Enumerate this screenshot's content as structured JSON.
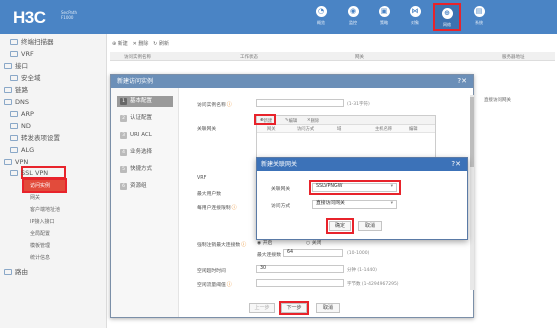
{
  "brand": {
    "logo": "H3C",
    "sub_line1": "SecPath",
    "sub_line2": "F1000"
  },
  "topnav": [
    {
      "label": "概览",
      "icon": "dashboard-icon",
      "glyph": "◔"
    },
    {
      "label": "监控",
      "icon": "monitor-icon",
      "glyph": "◉"
    },
    {
      "label": "策略",
      "icon": "policy-icon",
      "glyph": "▣"
    },
    {
      "label": "对象",
      "icon": "object-icon",
      "glyph": "⋈"
    },
    {
      "label": "网络",
      "icon": "network-icon",
      "glyph": "⊕"
    },
    {
      "label": "系统",
      "icon": "system-icon",
      "glyph": "▤"
    }
  ],
  "sidebar": {
    "items": [
      "终端扫描器",
      "VRF",
      "接口",
      "安全域",
      "链路",
      "DNS",
      "ARP",
      "ND",
      "转发表项设置",
      "ALG",
      "VPN",
      "SSL VPN",
      "访问实例",
      "网关",
      "客户端地址池",
      "IP接入接口",
      "全局配置",
      "模板管理",
      "统计信息",
      "路由"
    ]
  },
  "toolbar": {
    "new": "新建",
    "delete": "删除",
    "refresh": "刷新"
  },
  "table": {
    "col_name": "访问实例名称",
    "col_status": "工作状态",
    "col_gw": "网关",
    "col_addr": "服务器地址",
    "cell_gw": "直接访问网关"
  },
  "modal": {
    "title": "新建访问实例",
    "tabs": [
      "基本配置",
      "认证配置",
      "URI ACL",
      "业务选择",
      "快捷方式",
      "资源组"
    ],
    "field_name": "访问实例名称",
    "name_hint": "(1-31字符)",
    "field_gw": "关联网关",
    "grid_new": "新建",
    "grid_edit": "编辑",
    "grid_delete": "删除",
    "grid_cols": [
      "网关",
      "访问方式",
      "域",
      "主机名称",
      "编辑"
    ],
    "vrf": "VRF",
    "max_users": "最大用户数",
    "per_user": "每用户连接限制",
    "force_logout": "强制注销最大连接数",
    "on": "开启",
    "off": "关闭",
    "max_conn": "最大连接数",
    "max_conn_val": "64",
    "max_conn_hint": "(10-1000)",
    "idle_timeout": "空闲超时时间",
    "idle_val": "30",
    "idle_hint": "分钟 (1-1440)",
    "idle_flow": "空闲流量阈值",
    "idle_flow_hint": "字节数 (1-4294967295)",
    "prev": "上一步",
    "next": "下一步",
    "cancel": "取消"
  },
  "dialog": {
    "title": "新建关联网关",
    "gateway_label": "关联网关",
    "gateway_value": "SSLVPNGW",
    "mode_label": "访问方式",
    "mode_value": "直接访问网关",
    "ok": "确定",
    "cancel": "取消"
  }
}
